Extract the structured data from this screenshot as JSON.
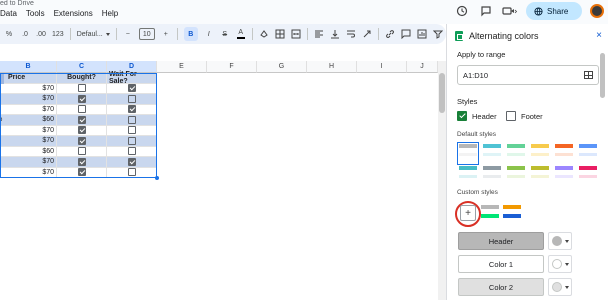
{
  "titlebar": {
    "saved_text": "ed to Drive"
  },
  "menus": [
    "Data",
    "Tools",
    "Extensions",
    "Help"
  ],
  "top_icons": [
    "history-icon",
    "comment-icon",
    "video-icon"
  ],
  "share": {
    "label": "Share"
  },
  "toolbar": {
    "percent": "%",
    "decimals": ".0",
    "decimals_more": ".00",
    "number_format": "123",
    "font": "Defaul...",
    "minus": "−",
    "font_size": "10",
    "plus": "+",
    "bold": "B",
    "italic": "I",
    "strike": "S",
    "text_color": "A"
  },
  "columns": [
    "B",
    "C",
    "D",
    "E",
    "F",
    "G",
    "H",
    "I",
    "J"
  ],
  "sheet": {
    "headers": {
      "price": "Price",
      "bought": "Bought?",
      "wait": "Wait For Sale?"
    },
    "rows": [
      {
        "price": "$70",
        "bought": false,
        "wait": true
      },
      {
        "price": "$70",
        "bought": true,
        "wait": false
      },
      {
        "price": "$70",
        "bought": false,
        "wait": true
      },
      {
        "price": "$60",
        "bought": true,
        "wait": false
      },
      {
        "price": "$70",
        "bought": true,
        "wait": false
      },
      {
        "price": "$70",
        "bought": true,
        "wait": false
      },
      {
        "price": "$60",
        "bought": false,
        "wait": false
      },
      {
        "price": "$70",
        "bought": true,
        "wait": true
      },
      {
        "price": "$70",
        "bought": true,
        "wait": false
      }
    ],
    "row_label_b": "b"
  },
  "panel": {
    "title": "Alternating colors",
    "close": "×",
    "apply_to_range_label": "Apply to range",
    "range_value": "A1:D10",
    "styles_label": "Styles",
    "header_label": "Header",
    "footer_label": "Footer",
    "header_checked": true,
    "footer_checked": false,
    "default_styles_label": "Default styles",
    "custom_styles_label": "Custom styles",
    "add_button": "+",
    "header_button": "Header",
    "color1_button": "Color 1",
    "color2_button": "Color 2"
  },
  "colors": {
    "row_band": "#c9d7ee",
    "selection": "#1a73e8",
    "header_swatch_gray": "#b7b7b7",
    "color1_swatch": "#ffffff",
    "color2_swatch": "#e0e0e0"
  },
  "default_swatches": [
    [
      "#b7b7b7",
      "#f3f3f3"
    ],
    [
      "#4fc3d4",
      "#dff4f7"
    ],
    [
      "#63d297",
      "#e0f7ea"
    ],
    [
      "#f7cb4d",
      "#fdf0c9"
    ],
    [
      "#f46524",
      "#fde1d3"
    ],
    [
      "#5b95f9",
      "#dce8fd"
    ],
    [
      "#46bdc6",
      "#dbf2f4"
    ],
    [
      "#8d9aa3",
      "#e9ecee"
    ],
    [
      "#8bc34a",
      "#ebf5dd"
    ],
    [
      "#bdbd2d",
      "#f4f4d6"
    ],
    [
      "#9c86ff",
      "#ebe6ff"
    ],
    [
      "#e91e63",
      "#fbd5e2"
    ]
  ],
  "custom_swatches": [
    {
      "header": "#b7b7b7",
      "row1": "#ffffff",
      "row2": "#00e676"
    },
    {
      "header": "#f29900",
      "row1": "#ffffff",
      "row2": "#1a5ed4"
    }
  ]
}
